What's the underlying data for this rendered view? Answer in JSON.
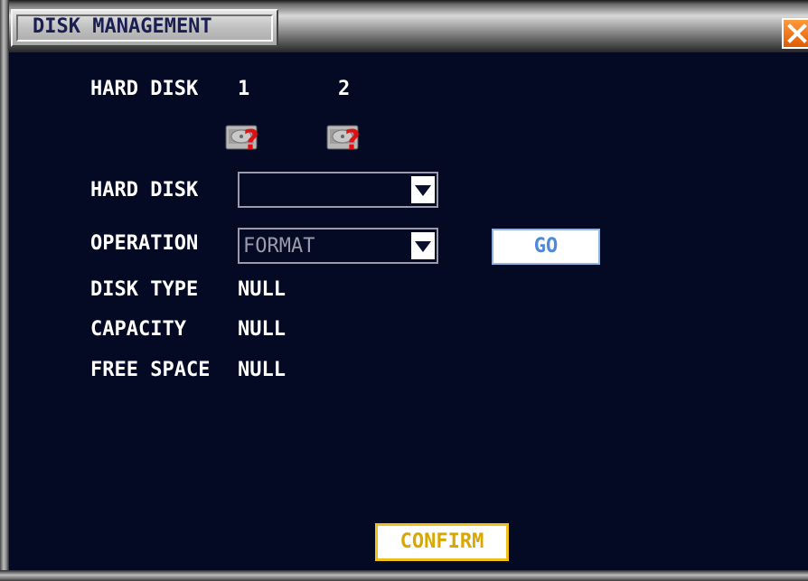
{
  "window": {
    "title": "DISK MANAGEMENT"
  },
  "header": {
    "hard_disk_label": "HARD DISK",
    "disk_numbers": [
      "1",
      "2"
    ],
    "disk_icons": [
      "disk-unknown-icon",
      "disk-unknown-icon"
    ]
  },
  "form": {
    "hard_disk_label": "HARD DISK",
    "hard_disk_value": "",
    "operation_label": "OPERATION",
    "operation_value": "FORMAT",
    "go_label": "GO",
    "disk_type_label": "DISK TYPE",
    "disk_type_value": "NULL",
    "capacity_label": "CAPACITY",
    "capacity_value": "NULL",
    "free_space_label": "FREE SPACE",
    "free_space_value": "NULL"
  },
  "footer": {
    "confirm_label": "CONFIRM"
  },
  "colors": {
    "background": "#040a24",
    "go_text": "#4f88d8",
    "confirm_border": "#f0c018",
    "close_button": "#f07a10"
  }
}
